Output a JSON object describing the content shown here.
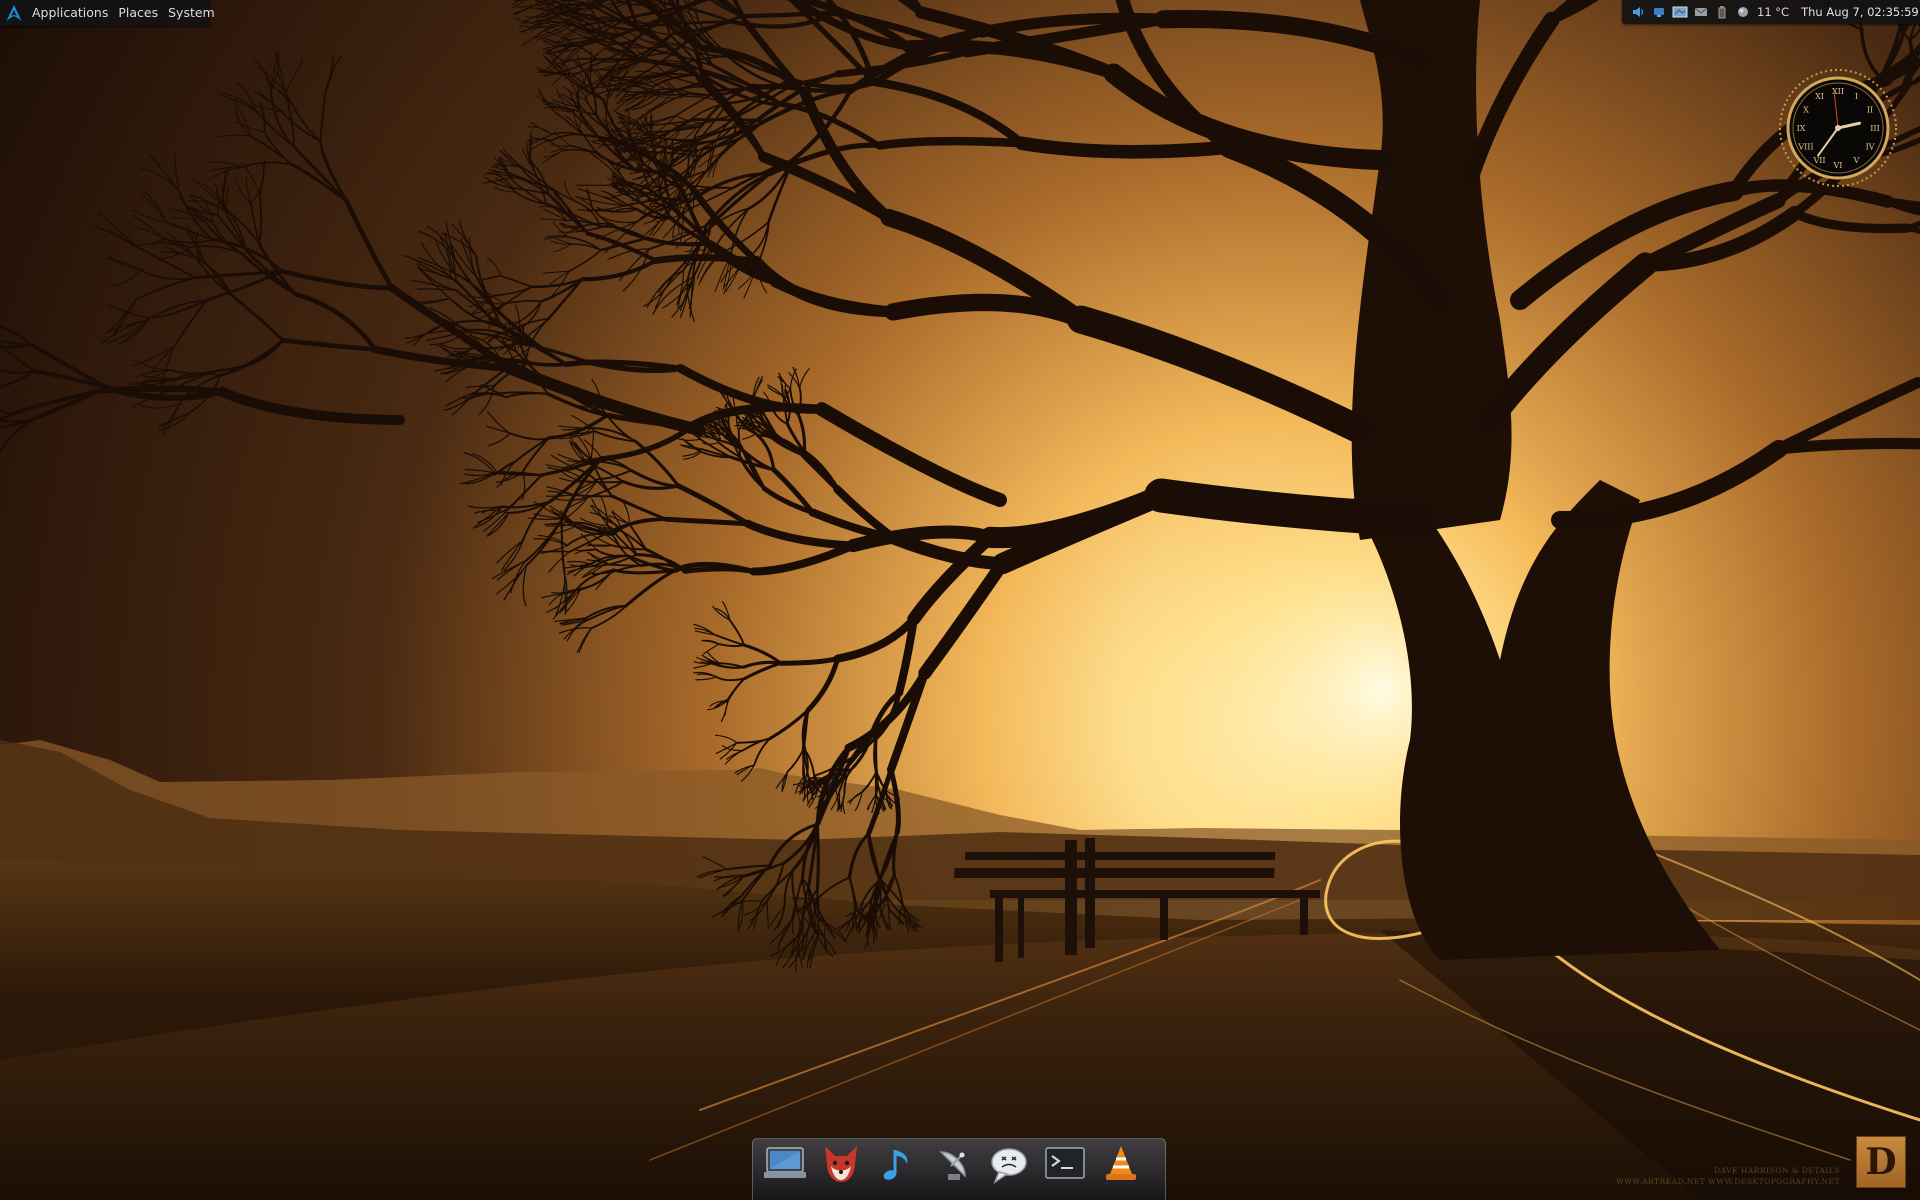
{
  "panel": {
    "menus": [
      "Applications",
      "Places",
      "System"
    ],
    "weather": "11 °C",
    "datetime": "Thu Aug  7, 02:35:59",
    "tray_icons": [
      "volume-icon",
      "network-icon",
      "screen-icon",
      "mail-icon",
      "battery-icon",
      "weather-icon"
    ]
  },
  "clock_widget": {
    "hour": 2,
    "minute": 35,
    "second": 59
  },
  "credits": {
    "line1": "DAVE HARRISON & DETAILS",
    "line2": "WWW.ARTREAD.NET    WWW.DESKTOPOGRAPHY.NET"
  },
  "corner_logo": "D",
  "dock": {
    "items": [
      "computer-icon",
      "fox-icon",
      "music-icon",
      "satellite-icon",
      "chat-icon",
      "terminal-icon",
      "vlc-icon"
    ]
  },
  "colors": {
    "panel_bg": "#121214",
    "panel_text": "#dcdcdc",
    "arch_blue": "#1793d1",
    "sky_glow": "#fff0b0",
    "logo_orange": "#c88a3e"
  }
}
